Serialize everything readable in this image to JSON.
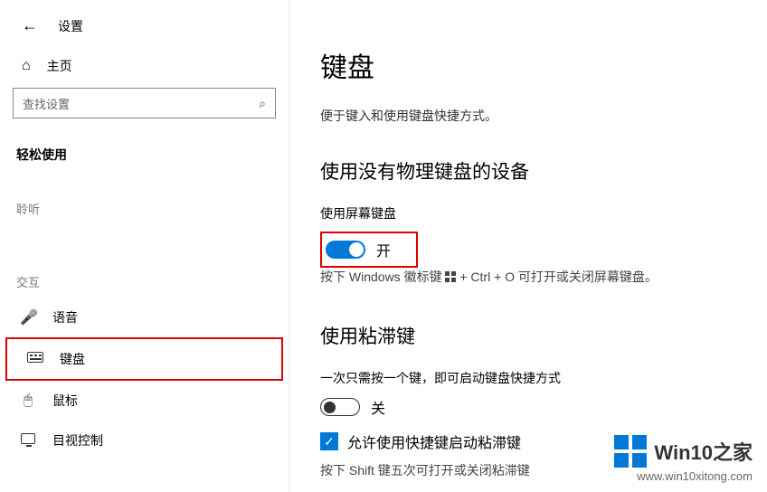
{
  "header": {
    "app_title": "设置"
  },
  "sidebar": {
    "home": "主页",
    "search_placeholder": "查找设置",
    "section_access": "轻松使用",
    "section_hear": "聆听",
    "section_interact": "交互",
    "items": {
      "voice": "语音",
      "keyboard": "键盘",
      "mouse": "鼠标",
      "eye": "目视控制"
    }
  },
  "main": {
    "title": "键盘",
    "subtitle": "便于键入和使用键盘快捷方式。",
    "section1": {
      "heading": "使用没有物理键盘的设备",
      "label": "使用屏幕键盘",
      "toggle_state": "开",
      "hint_pre": "按下 Windows 徽标键 ",
      "hint_post": " + Ctrl + O 可打开或关闭屏幕键盘。"
    },
    "section2": {
      "heading": "使用粘滞键",
      "label": "一次只需按一个键，即可启动键盘快捷方式",
      "toggle_state": "关",
      "checkbox_label": "允许使用快捷键启动粘滞键",
      "hint": "按下 Shift 键五次可打开或关闭粘滞键"
    }
  },
  "watermark": {
    "brand": "Win10之家",
    "url": "www.win10xitong.com"
  }
}
